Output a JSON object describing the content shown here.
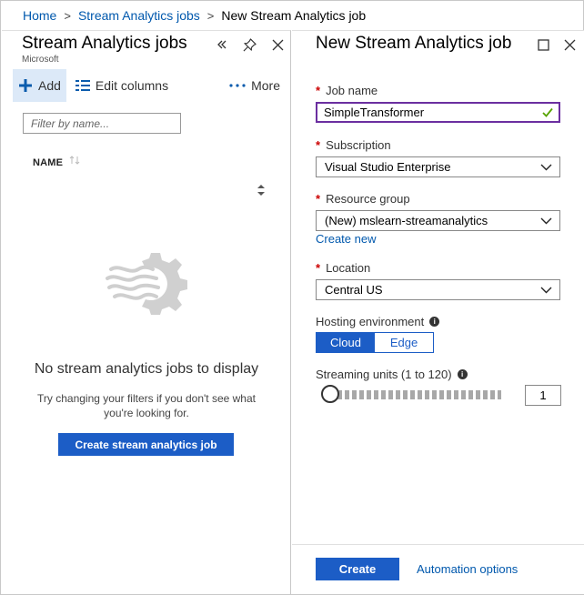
{
  "breadcrumb": {
    "home": "Home",
    "jobs": "Stream Analytics jobs",
    "current": "New Stream Analytics job"
  },
  "left_blade": {
    "title": "Stream Analytics jobs",
    "subtitle": "Microsoft",
    "toolbar": {
      "add_label": "Add",
      "edit_columns_label": "Edit columns",
      "more_label": "More"
    },
    "filter_placeholder": "Filter by name...",
    "column_header": "NAME",
    "empty_title": "No stream analytics jobs to display",
    "empty_hint": "Try changing your filters if you don't see what you're looking for.",
    "create_button": "Create stream analytics job"
  },
  "right_blade": {
    "title": "New Stream Analytics job",
    "job_name": {
      "label": "Job name",
      "value": "SimpleTransformer"
    },
    "subscription": {
      "label": "Subscription",
      "value": "Visual Studio Enterprise"
    },
    "resource_group": {
      "label": "Resource group",
      "value": "(New) mslearn-streamanalytics",
      "create_new": "Create new"
    },
    "location": {
      "label": "Location",
      "value": "Central US"
    },
    "hosting": {
      "label": "Hosting environment",
      "options": [
        "Cloud",
        "Edge"
      ],
      "selected": "Cloud"
    },
    "streaming_units": {
      "label": "Streaming units (1 to 120)",
      "value": "1"
    },
    "create_button": "Create",
    "automation_link": "Automation options"
  },
  "colors": {
    "accent": "#1c5dc6",
    "link": "#0058ad",
    "required": "#cc0000",
    "valid_check": "#57a300",
    "focus_border": "#6b2fa0"
  },
  "icons": [
    "plus-icon",
    "edit-columns-icon",
    "more-icon",
    "collapse-icon",
    "pin-icon",
    "close-icon",
    "maximize-icon",
    "sort-icon",
    "scroll-arrows-icon",
    "stream-analytics-gear-icon",
    "checkmark-icon",
    "chevron-down-icon",
    "info-icon"
  ]
}
